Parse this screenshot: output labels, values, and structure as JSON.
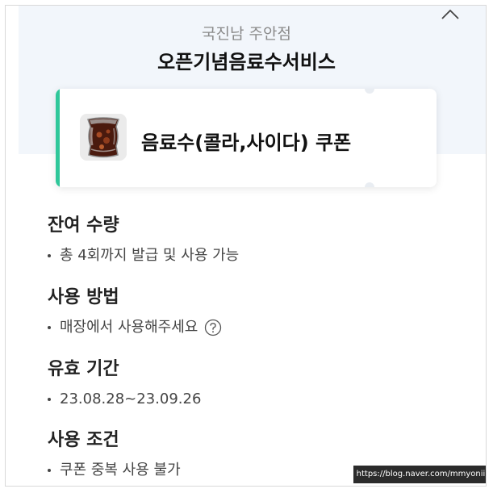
{
  "header": {
    "store_name": "국진남 주안점",
    "event_title": "오픈기념음료수서비스"
  },
  "coupon": {
    "name": "음료수(콜라,사이다) 쿠폰",
    "thumbnail_icon": "cola-glass-image",
    "accent_color": "#2fc79a"
  },
  "sections": [
    {
      "title": "잔여 수량",
      "text": "총 4회까지 발급 및 사용 가능"
    },
    {
      "title": "사용 방법",
      "text": "매장에서 사용해주세요"
    },
    {
      "title": "유효 기간",
      "text": "23.08.28~23.09.26"
    },
    {
      "title": "사용 조건",
      "text": "쿠폰 중복 사용 불가"
    }
  ],
  "icons": {
    "collapse": "chevron-up-icon",
    "help": "question-circle-icon"
  },
  "watermark": "https://blog.naver.com/mmyonii"
}
